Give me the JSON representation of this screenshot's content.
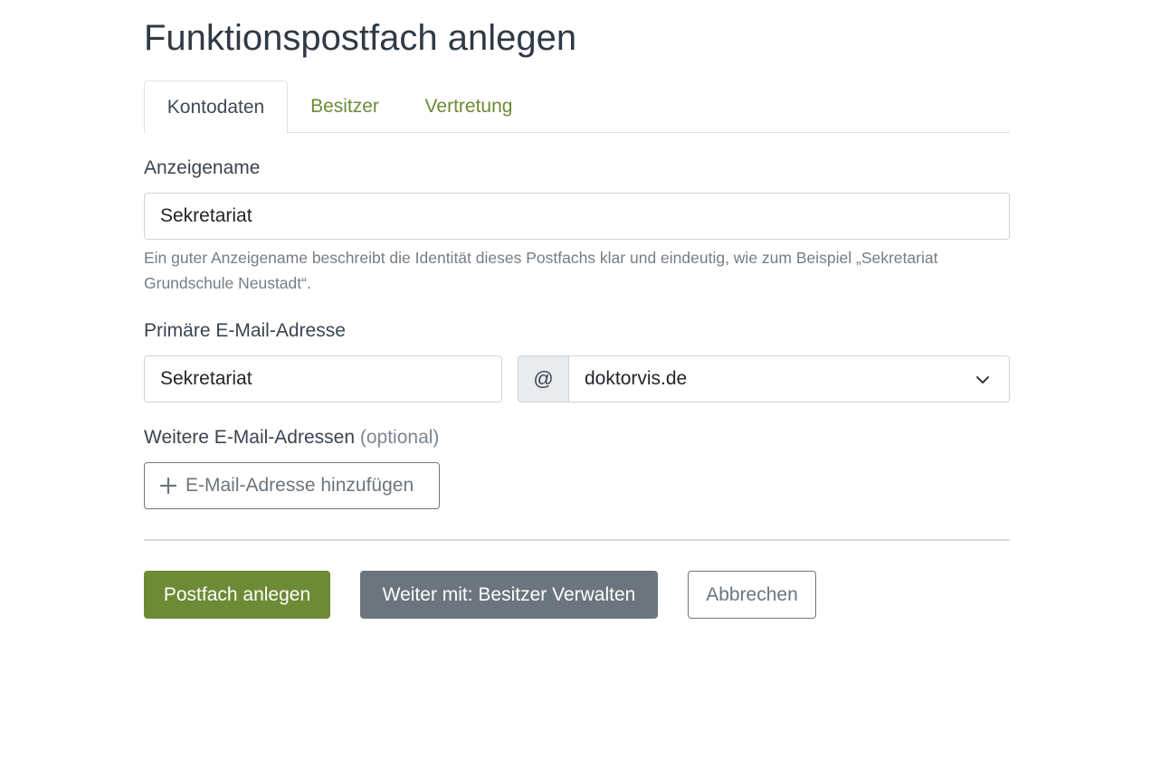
{
  "page": {
    "title": "Funktionspostfach anlegen"
  },
  "tabs": [
    {
      "label": "Kontodaten",
      "active": true
    },
    {
      "label": "Besitzer",
      "active": false
    },
    {
      "label": "Vertretung",
      "active": false
    }
  ],
  "display_name": {
    "label": "Anzeigename",
    "value": "Sekretariat",
    "help_text": "Ein guter Anzeigename beschreibt die Identität dieses Postfachs klar und eindeutig, wie zum Beispiel „Sekretariat Grundschule Neustadt“."
  },
  "primary_email": {
    "label": "Primäre E-Mail-Adresse",
    "local_part": "Sekretariat",
    "at_symbol": "@",
    "domain_selected": "doktorvis.de"
  },
  "additional_emails": {
    "label": "Weitere E-Mail-Adressen",
    "optional_suffix": "(optional)",
    "add_button_label": "E-Mail-Adresse hinzufügen"
  },
  "actions": {
    "create_label": "Postfach anlegen",
    "next_label": "Weiter mit: Besitzer Verwalten",
    "cancel_label": "Abbrechen"
  },
  "colors": {
    "brand_green": "#6d8a35",
    "secondary_gray": "#6c757d",
    "text_dark": "#2f3a45"
  },
  "icons": {
    "select_chevron": "chevron-down-icon",
    "add": "plus-icon"
  }
}
